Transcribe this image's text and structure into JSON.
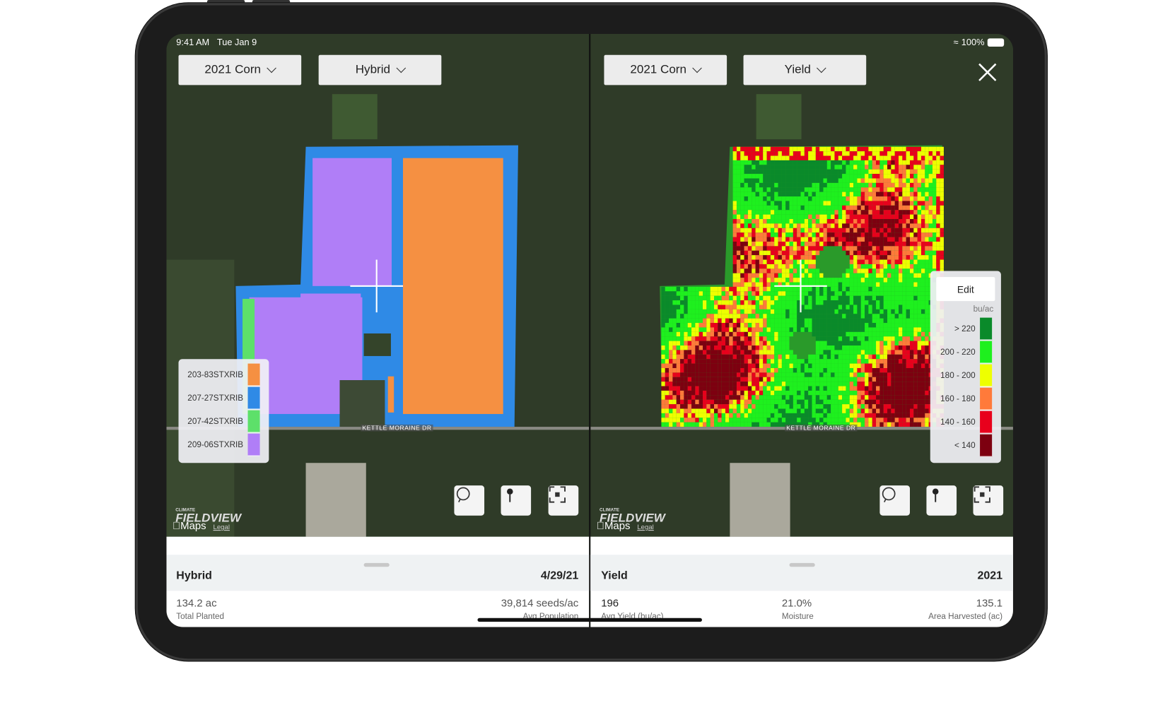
{
  "status_bar": {
    "time": "9:41 AM",
    "date": "Tue Jan 9",
    "battery": "100%"
  },
  "left": {
    "season_dropdown": "2021 Corn",
    "layer_dropdown": "Hybrid",
    "legend": [
      {
        "label": "203-83STXRIB",
        "color": "#f59042"
      },
      {
        "label": "207-27STXRIB",
        "color": "#2f8ae6"
      },
      {
        "label": "207-42STXRIB",
        "color": "#5de06a"
      },
      {
        "label": "209-06STXRIB",
        "color": "#b07ef7"
      }
    ],
    "road_label": "KETTLE MORAINE DR",
    "panel": {
      "title": "Hybrid",
      "date": "4/29/21",
      "stats": [
        {
          "value": "134.2 ac",
          "label": "Total Planted"
        },
        {
          "value": "39,814 seeds/ac",
          "label": "Avg Population"
        }
      ]
    }
  },
  "right": {
    "season_dropdown": "2021 Corn",
    "layer_dropdown": "Yield",
    "legend": {
      "edit_label": "Edit",
      "unit": "bu/ac",
      "items": [
        {
          "label": "> 220",
          "color": "#0a8a2a"
        },
        {
          "label": "200 - 220",
          "color": "#1ef01e"
        },
        {
          "label": "180 - 200",
          "color": "#eeff00"
        },
        {
          "label": "160 - 180",
          "color": "#ff7a3a"
        },
        {
          "label": "140 - 160",
          "color": "#e8001c"
        },
        {
          "label": "< 140",
          "color": "#7d0010"
        }
      ]
    },
    "road_label": "KETTLE MORAINE DR",
    "panel": {
      "title": "Yield",
      "year": "2021",
      "stats": [
        {
          "value": "196",
          "label": "Avg Yield (bu/ac)"
        },
        {
          "value": "21.0%",
          "label": "Moisture"
        },
        {
          "value": "135.1",
          "label": "Area Harvested (ac)"
        }
      ]
    }
  },
  "branding": {
    "climate": "CLIMATE",
    "fieldview": "FIELDVIEW",
    "maps": "Maps",
    "legal": "Legal"
  },
  "icons": [
    "close-icon",
    "lasso-icon",
    "pin-icon",
    "fit-extent-icon",
    "chevron-down-icon",
    "wifi-icon",
    "battery-icon",
    "crosshair-icon"
  ]
}
